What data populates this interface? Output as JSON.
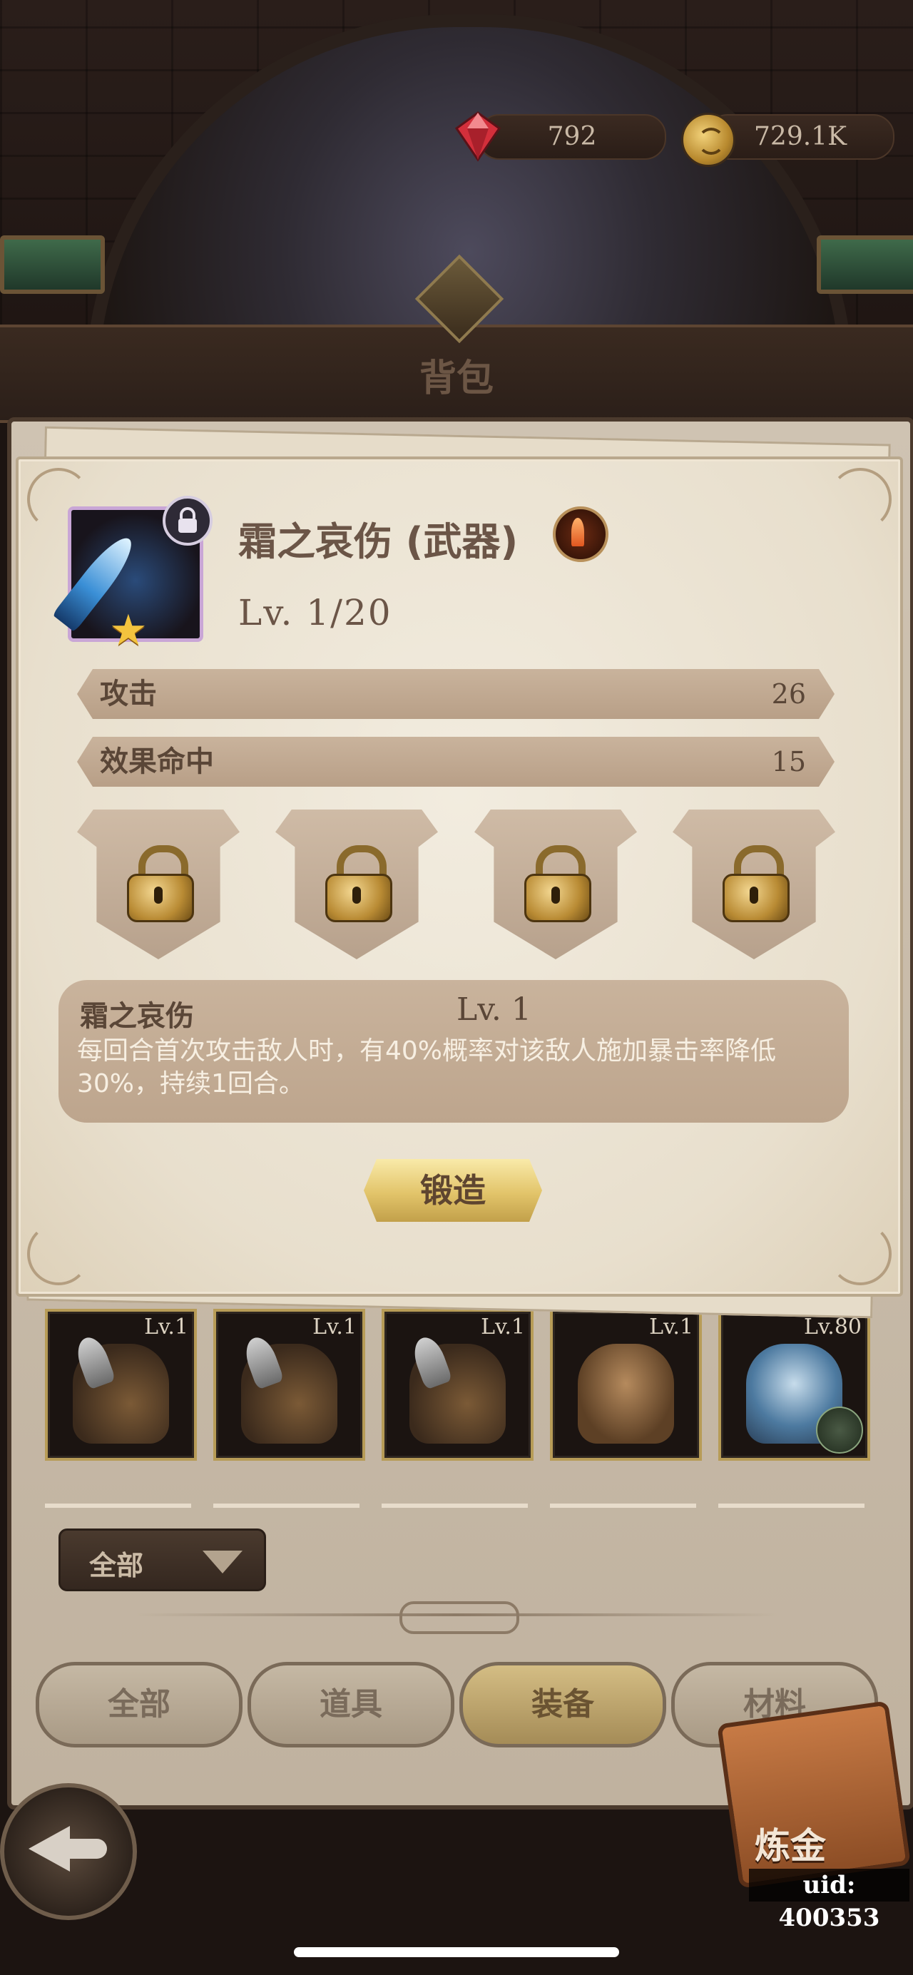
{
  "currency": {
    "gems": "792",
    "gold": "729.1K"
  },
  "header": {
    "title": "背包"
  },
  "item": {
    "name": "霜之哀伤 (武器)",
    "level": "Lv. 1/20",
    "locked": true,
    "stars": 1,
    "type_icon": "weapon-type-icon"
  },
  "stats": [
    {
      "label": "攻击",
      "value": "26"
    },
    {
      "label": "效果命中",
      "value": "15"
    }
  ],
  "rune_slots": [
    {
      "state": "locked"
    },
    {
      "state": "locked"
    },
    {
      "state": "locked"
    },
    {
      "state": "locked"
    }
  ],
  "skill": {
    "name": "霜之哀伤",
    "level": "Lv. 1",
    "description": "每回合首次攻击敌人时，有40%概率对该敌人施加暴击率降低30%，持续1回合。"
  },
  "forge_button": "锻造",
  "inventory": [
    {
      "level": "Lv.1",
      "item": "pauldron"
    },
    {
      "level": "Lv.1",
      "item": "pauldron"
    },
    {
      "level": "Lv.1",
      "item": "pauldron"
    },
    {
      "level": "Lv.1",
      "item": "straw-hat"
    },
    {
      "level": "Lv.80",
      "item": "helmet"
    }
  ],
  "filter": {
    "selected": "全部"
  },
  "tabs": [
    {
      "label": "全部",
      "active": false
    },
    {
      "label": "道具",
      "active": false
    },
    {
      "label": "装备",
      "active": true
    },
    {
      "label": "材料",
      "active": false
    }
  ],
  "alchemy_button": "炼金",
  "uid": "uid: 400353",
  "colors": {
    "modal_bg": "#efe7d8",
    "stat_bar": "#c1aa93",
    "forge_gold": "#e2c46a",
    "active_tab": "#c3a86e"
  }
}
